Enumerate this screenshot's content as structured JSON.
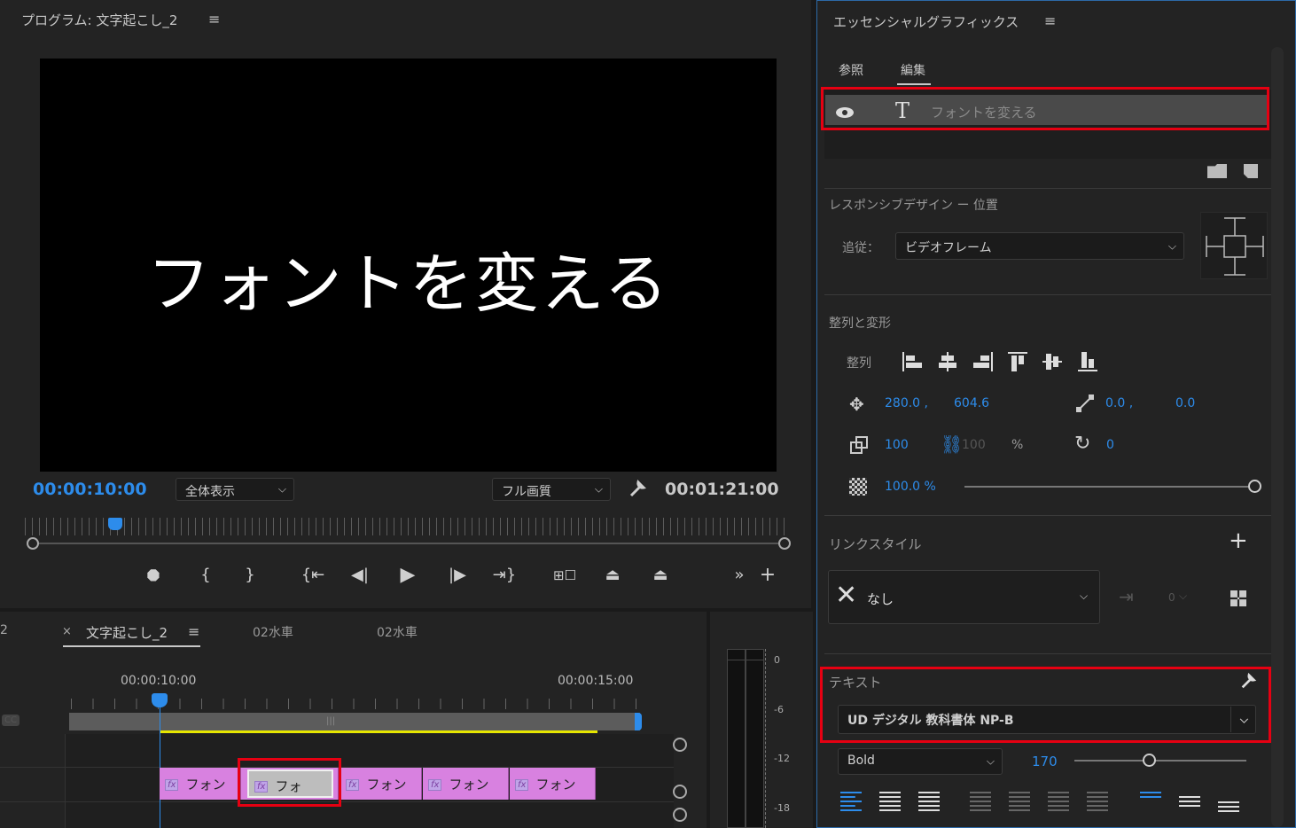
{
  "program_monitor": {
    "title": "プログラム: 文字起こし_2",
    "video_text": "フォントを変える",
    "current_timecode": "00:00:10:00",
    "zoom_select": "全体表示",
    "quality_select": "フル画質",
    "duration_timecode": "00:01:21:00"
  },
  "timeline": {
    "tab_prefix": "2",
    "tabs": [
      {
        "label": "文字起こし_2",
        "active": true
      },
      {
        "label": "02水車"
      },
      {
        "label": "02水車"
      }
    ],
    "ruler_labels": [
      "00:00:10:00",
      "00:00:15:00"
    ],
    "clips": [
      {
        "label": "フォン",
        "fx": "fx"
      },
      {
        "label": "フォ",
        "fx": "fx",
        "selected": true
      },
      {
        "label": "フォン",
        "fx": "fx"
      },
      {
        "label": "フォン",
        "fx": "fx"
      },
      {
        "label": "フォン",
        "fx": "fx"
      }
    ],
    "cc_label": "CC"
  },
  "audio_meter": {
    "labels": [
      "0",
      "-6",
      "-12",
      "-18"
    ]
  },
  "essential_graphics": {
    "title": "エッセンシャルグラフィックス",
    "tabs": [
      "参照",
      "編集"
    ],
    "active_tab": "編集",
    "layer_name": "フォントを変える",
    "responsive_title": "レスポンシブデザイン ー 位置",
    "follow_label": "追従：",
    "follow_value": "ビデオフレーム",
    "align_title": "整列と変形",
    "align_label": "整列",
    "position_x": "280.0 ,",
    "position_y": "604.6",
    "anchor_x": "0.0 ,",
    "anchor_y": "0.0",
    "scale": "100",
    "scale_linked": "100",
    "scale_unit": "%",
    "rotation": "0",
    "opacity": "100.0 %",
    "link_style_title": "リンクスタイル",
    "link_style_value": "なし",
    "link_small_value": "0",
    "text_title": "テキスト",
    "font_name": "UD デジタル 教科書体 NP-B",
    "font_style": "Bold",
    "font_size": "170"
  },
  "colors": {
    "accent_blue": "#2d8ceb",
    "highlight_red": "#e60012",
    "clip_pink": "#d881e0"
  }
}
